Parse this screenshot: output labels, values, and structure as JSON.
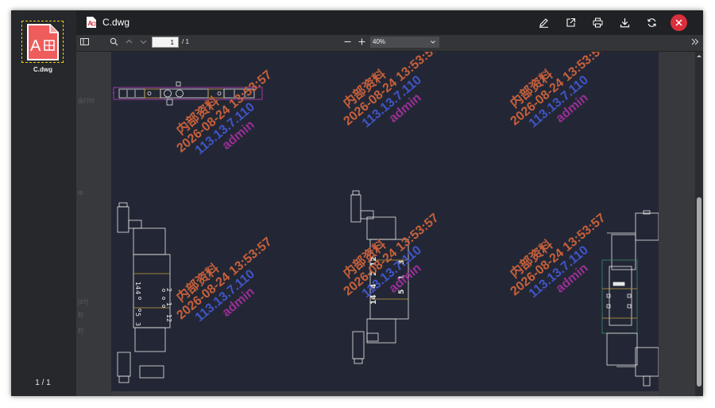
{
  "file": {
    "name": "C.dwg"
  },
  "thumbnails": [
    {
      "label": "C.dwg"
    }
  ],
  "page_count": "1 / 1",
  "toolbar": {
    "page_number": "1",
    "page_total": "/ 1",
    "zoom": "40%"
  },
  "watermark": {
    "line1": "内部资料",
    "line2": "2026-08-24 13:53:57",
    "line3": "113.13.7.110",
    "line4": "admin",
    "colors": {
      "line1": "#c8603a",
      "line2": "#c8603a",
      "line3": "#4055c8",
      "line4": "#9a2f96"
    }
  },
  "background_text": {
    "label1": "运行时",
    "label2": "IB",
    "label3": "[ST]",
    "label4": "的",
    "label5": "的"
  },
  "cad_labels": {
    "valve2_a": "14",
    "valve2_b": "4",
    "valve2_c": "2",
    "valve2_d": "12",
    "valve2_e": "5",
    "valve2_f": "1",
    "valve2_g": "3",
    "valve1_a": "14",
    "valve1_b": "4",
    "valve1_c": "5",
    "valve1_d": "3",
    "valve1_e": "2",
    "valve1_f": "1",
    "valve1_g": "12"
  },
  "colors": {
    "accent_close": "#d9303c",
    "thumb_border": "#f0d000",
    "cad_background": "#232735"
  }
}
